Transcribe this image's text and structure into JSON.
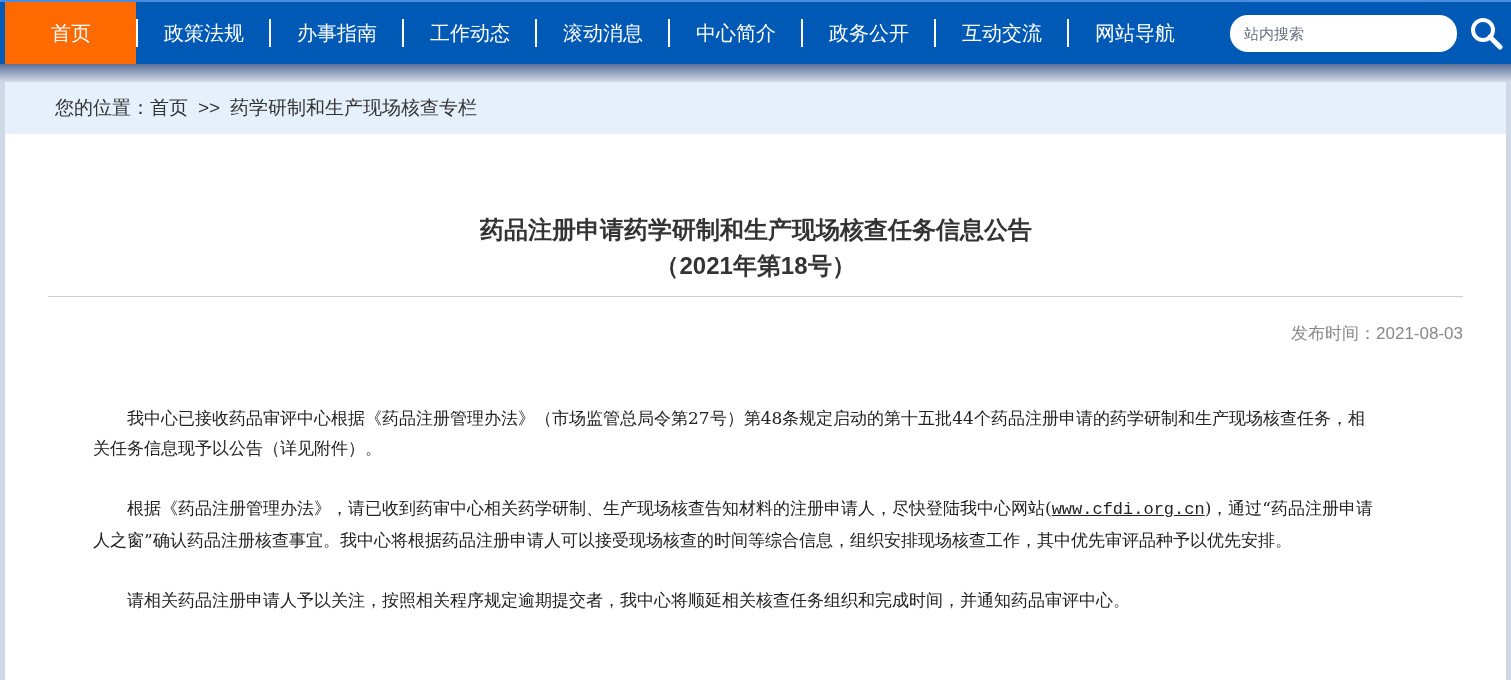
{
  "nav": {
    "items": [
      {
        "label": "首页",
        "selected": true
      },
      {
        "label": "政策法规",
        "selected": false
      },
      {
        "label": "办事指南",
        "selected": false
      },
      {
        "label": "工作动态",
        "selected": false
      },
      {
        "label": "滚动消息",
        "selected": false
      },
      {
        "label": "中心简介",
        "selected": false
      },
      {
        "label": "政务公开",
        "selected": false
      },
      {
        "label": "互动交流",
        "selected": false
      },
      {
        "label": "网站导航",
        "selected": false
      }
    ],
    "search": {
      "placeholder": "站内搜索"
    }
  },
  "breadcrumb": {
    "label": "您的位置：",
    "items": [
      "首页",
      "药学研制和生产现场核查专栏"
    ],
    "separator": ">>"
  },
  "article": {
    "title": "药品注册申请药学研制和生产现场核查任务信息公告",
    "subtitle": "（2021年第18号）",
    "date": "发布时间：2021-08-03",
    "paragraphs": [
      {
        "text": "我中心已接收药品审评中心根据《药品注册管理办法》（市场监管总局令第27号）第48条规定启动的第十五批44个药品注册申请的药学研制和生产现场核查任务，相关任务信息现予以公告（详见附件）。"
      },
      {
        "text": "根据《药品注册管理办法》，请已收到药审中心相关药学研制、生产现场核查告知材料的注册申请人，尽快登陆我中心网站(",
        "link": "www.cfdi.org.cn",
        "after": ")，通过“药品注册申请人之窗”确认药品注册核查事宜。我中心将根据药品注册申请人可以接受现场核查的时间等综合信息，组织安排现场核查工作，其中优先审评品种予以优先安排。"
      },
      {
        "text": "请相关药品注册申请人予以关注，按照相关程序规定逾期提交者，我中心将顺延相关核查任务组织和完成时间，并通知药品审评中心。"
      }
    ]
  }
}
